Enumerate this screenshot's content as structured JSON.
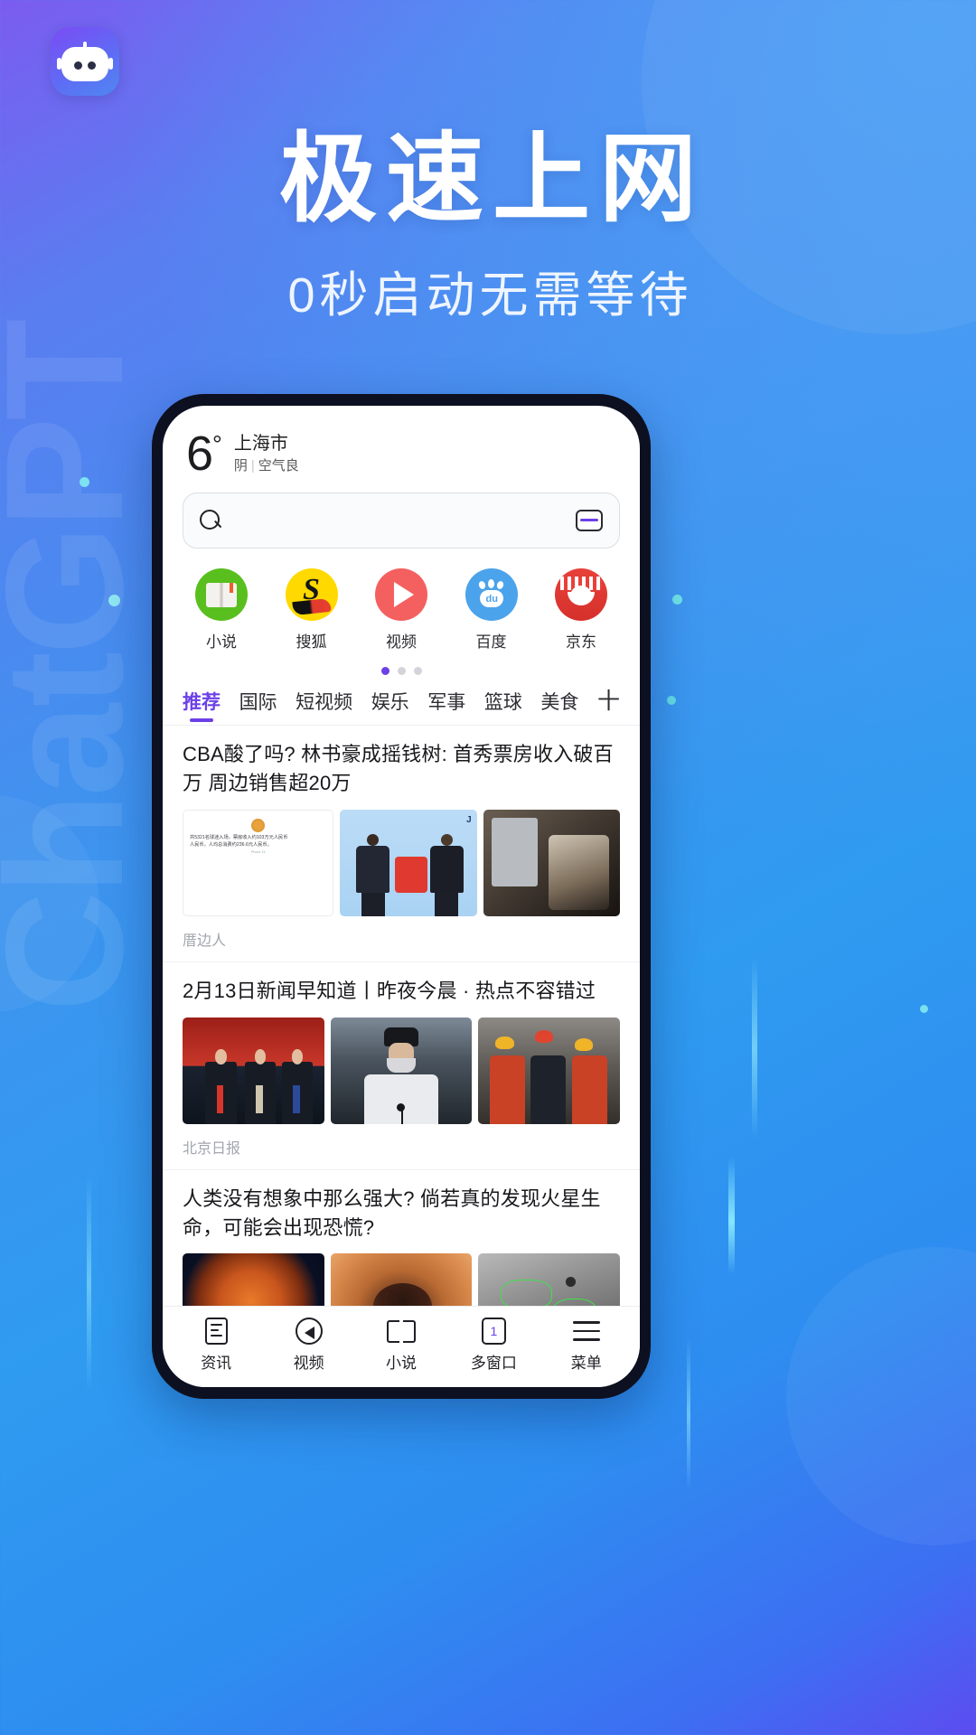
{
  "promo": {
    "title": "极速上网",
    "subtitle": "0秒启动无需等待",
    "logo_icon": "robot-logo-icon",
    "watermark": "ChatGPT",
    "brand_gradient_start": "#7b5cf0",
    "brand_gradient_end": "#2f9bf0",
    "accent_purple": "#6c40e8"
  },
  "phone": {
    "weather": {
      "temperature": "6",
      "degree_symbol": "°",
      "city": "上海市",
      "condition": "阴",
      "separator": "|",
      "air_quality": "空气良"
    },
    "search": {
      "placeholder": "",
      "value": "",
      "search_icon": "search-icon",
      "multiwindow_icon": "multi-window-icon"
    },
    "shortcuts": [
      {
        "label": "小说",
        "icon": "novel-book-icon",
        "color": "#59bf1e"
      },
      {
        "label": "搜狐",
        "icon": "sohu-icon",
        "color": "#ffd900"
      },
      {
        "label": "视频",
        "icon": "video-play-icon",
        "color": "#f4605f"
      },
      {
        "label": "百度",
        "icon": "baidu-paw-icon",
        "color": "#4ba3eb"
      },
      {
        "label": "京东",
        "icon": "jd-icon",
        "color": "#e8413a"
      }
    ],
    "pager": {
      "total": 3,
      "active_index": 0
    },
    "tabs": [
      {
        "label": "推荐",
        "active": true
      },
      {
        "label": "国际",
        "active": false
      },
      {
        "label": "短视频",
        "active": false
      },
      {
        "label": "娱乐",
        "active": false
      },
      {
        "label": "军事",
        "active": false
      },
      {
        "label": "篮球",
        "active": false
      },
      {
        "label": "美食",
        "active": false
      }
    ],
    "tab_add": "十",
    "articles": [
      {
        "title": "CBA酸了吗? 林书豪成摇钱树: 首秀票房收入破百万 周边销售超20万",
        "source": "厝边人",
        "thumb_card": {
          "line1": "共5321名球迷入场，票房收入约103万元人民币",
          "line2": "人民币，人均总消费约236.6元人民币。",
          "caption": "Phone 13"
        },
        "jersey_number": "J"
      },
      {
        "title": "2月13日新闻早知道丨昨夜今晨 · 热点不容错过",
        "source": "北京日报"
      },
      {
        "title": "人类没有想象中那么强大? 倘若真的发现火星生命，可能会出现恐慌?",
        "source": ""
      }
    ],
    "bottom_nav": [
      {
        "label": "资讯",
        "icon": "news-document-icon",
        "badge": ""
      },
      {
        "label": "视频",
        "icon": "video-play-circle-icon",
        "badge": ""
      },
      {
        "label": "小说",
        "icon": "open-book-icon",
        "badge": ""
      },
      {
        "label": "多窗口",
        "icon": "multi-window-icon",
        "badge": "1"
      },
      {
        "label": "菜单",
        "icon": "hamburger-menu-icon",
        "badge": ""
      }
    ]
  }
}
